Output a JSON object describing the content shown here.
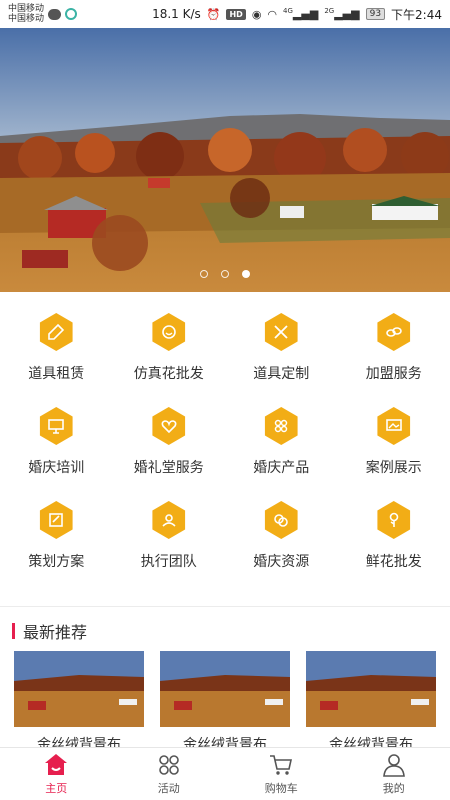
{
  "statusbar": {
    "carrier1": "中国移动",
    "carrier2": "中国移动",
    "speed": "18.1 K/s",
    "hd": "HD",
    "net1": "4G",
    "net2": "2G",
    "battery": "93",
    "time": "下午2:44"
  },
  "banner": {
    "slide_count": 3,
    "active_slide": 3
  },
  "grid": {
    "items": [
      {
        "label": "道具租赁",
        "icon": "prop-icon"
      },
      {
        "label": "仿真花批发",
        "icon": "flower-wholesale-icon"
      },
      {
        "label": "道具定制",
        "icon": "custom-icon"
      },
      {
        "label": "加盟服务",
        "icon": "link-icon"
      },
      {
        "label": "婚庆培训",
        "icon": "training-icon"
      },
      {
        "label": "婚礼堂服务",
        "icon": "heart-icon"
      },
      {
        "label": "婚庆产品",
        "icon": "products-icon"
      },
      {
        "label": "案例展示",
        "icon": "showcase-icon"
      },
      {
        "label": "策划方案",
        "icon": "plan-icon"
      },
      {
        "label": "执行团队",
        "icon": "team-icon"
      },
      {
        "label": "婚庆资源",
        "icon": "resource-icon"
      },
      {
        "label": "鲜花批发",
        "icon": "flower-icon"
      }
    ],
    "icon_color": "#f2ad16"
  },
  "recommend": {
    "title": "最新推荐",
    "accent": "#e61f4e",
    "items": [
      {
        "name": "金丝绒背景布"
      },
      {
        "name": "金丝绒背景布"
      },
      {
        "name": "金丝绒背景布"
      }
    ]
  },
  "nav": {
    "items": [
      {
        "label": "主页",
        "icon": "home-icon",
        "active": true
      },
      {
        "label": "活动",
        "icon": "grid-icon",
        "active": false
      },
      {
        "label": "购物车",
        "icon": "cart-icon",
        "active": false
      },
      {
        "label": "我的",
        "icon": "user-icon",
        "active": false
      }
    ],
    "active_color": "#e61f4e"
  }
}
